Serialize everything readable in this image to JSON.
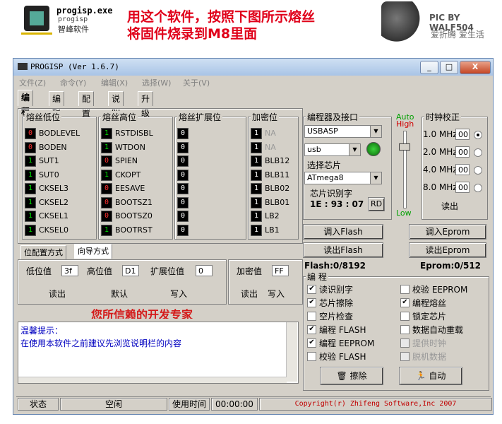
{
  "banner": {
    "app_file": "progisp.exe",
    "app_file2": "progisp",
    "app_cn": "智峰软件",
    "headline1": "用这个软件，按照下图所示熔丝",
    "headline2": "将固件烧录到M8里面",
    "picby": "PIC BY WALF504",
    "slogan": "爱折腾 爱生活"
  },
  "window": {
    "title": "PROGISP  (Ver 1.6.7)",
    "min": "_",
    "max": "□",
    "close": "X"
  },
  "menu": [
    "文件(Z)",
    "命令(Y)",
    "编辑(X)",
    "选择(W)",
    "关于(V)"
  ],
  "tabs": [
    "编 程",
    "编 辑",
    "配 置",
    "说 明",
    "升 级"
  ],
  "fuse": {
    "low_title": "熔丝低位",
    "high_title": "熔丝高位",
    "ext_title": "熔丝扩展位",
    "lock_title": "加密位",
    "low": [
      {
        "v": "0",
        "n": "BODLEVEL"
      },
      {
        "v": "0",
        "n": "BODEN"
      },
      {
        "v": "1",
        "n": "SUT1"
      },
      {
        "v": "1",
        "n": "SUT0"
      },
      {
        "v": "1",
        "n": "CKSEL3"
      },
      {
        "v": "1",
        "n": "CKSEL2"
      },
      {
        "v": "1",
        "n": "CKSEL1"
      },
      {
        "v": "1",
        "n": "CKSEL0"
      }
    ],
    "high": [
      {
        "v": "1",
        "n": "RSTDISBL"
      },
      {
        "v": "1",
        "n": "WTDON"
      },
      {
        "v": "0",
        "n": "SPIEN"
      },
      {
        "v": "1",
        "n": "CKOPT"
      },
      {
        "v": "0",
        "n": "EESAVE"
      },
      {
        "v": "0",
        "n": "BOOTSZ1"
      },
      {
        "v": "0",
        "n": "BOOTSZ0"
      },
      {
        "v": "1",
        "n": "BOOTRST"
      }
    ],
    "ext": [
      "0",
      "0",
      "0",
      "0",
      "0",
      "0",
      "0",
      "0"
    ],
    "lock": [
      {
        "v": "1",
        "n": "NA"
      },
      {
        "v": "1",
        "n": "NA"
      },
      {
        "v": "1",
        "n": "BLB12"
      },
      {
        "v": "1",
        "n": "BLB11"
      },
      {
        "v": "1",
        "n": "BLB02"
      },
      {
        "v": "1",
        "n": "BLB01"
      },
      {
        "v": "1",
        "n": "LB2"
      },
      {
        "v": "1",
        "n": "LB1"
      }
    ]
  },
  "subtabs": [
    "位配置方式",
    "向导方式"
  ],
  "values": {
    "low_label": "低位值",
    "low": "3f",
    "high_label": "高位值",
    "high": "D1",
    "ext_label": "扩展位值",
    "ext": "0",
    "lock_label": "加密值",
    "lock": "FF",
    "read": "读出",
    "default": "默认",
    "write": "写入",
    "read2": "读出",
    "write2": "写入"
  },
  "promo": "您所信赖的开发专家",
  "hint": {
    "title": "温馨提示：",
    "text": "在使用本软件之前建议先浏览说明栏的内容"
  },
  "programmer": {
    "title": "编程器及接口",
    "device": "USBASP",
    "port": "usb",
    "chip_title": "选择芯片",
    "chip": "ATmega8",
    "sig_title": "芯片识别字",
    "sig": "1E : 93 : 07",
    "rd": "RD",
    "auto": "Auto",
    "high": "High",
    "low": "Low"
  },
  "clock": {
    "title": "时钟校正",
    "rows": [
      {
        "f": "1.0 MHz",
        "v": "00",
        "on": true
      },
      {
        "f": "2.0 MHz",
        "v": "00",
        "on": false
      },
      {
        "f": "4.0 MHz",
        "v": "00",
        "on": false
      },
      {
        "f": "8.0 MHz",
        "v": "00",
        "on": false
      }
    ],
    "read": "读出"
  },
  "buttons": {
    "read_flash": "调入Flash",
    "save_flash": "读出Flash",
    "read_eprom": "调入Eprom",
    "save_eprom": "读出Eprom"
  },
  "flash_info": "Flash:0/8192",
  "eprom_info": "Eprom:0/512",
  "program": {
    "title": "编 程",
    "left": [
      {
        "l": "读识别字",
        "c": true,
        "d": false
      },
      {
        "l": "芯片擦除",
        "c": true,
        "d": false
      },
      {
        "l": "空片检查",
        "c": false,
        "d": false
      },
      {
        "l": "编程 FLASH",
        "c": true,
        "d": false
      },
      {
        "l": "编程 EEPROM",
        "c": true,
        "d": false
      },
      {
        "l": "校验 FLASH",
        "c": false,
        "d": false
      }
    ],
    "right": [
      {
        "l": "校验 EEPROM",
        "c": false,
        "d": false
      },
      {
        "l": "编程熔丝",
        "c": true,
        "d": false
      },
      {
        "l": "锁定芯片",
        "c": false,
        "d": false
      },
      {
        "l": "数据自动重载",
        "c": false,
        "d": false
      },
      {
        "l": "提供时钟",
        "c": false,
        "d": true
      },
      {
        "l": "脱机数据",
        "c": false,
        "d": true
      }
    ],
    "erase": "擦除",
    "auto": "自动"
  },
  "status": {
    "state_label": "状态",
    "state": "空闲",
    "time_label": "使用时间",
    "time": "00:00:00",
    "copyright": "Copyright(r) Zhifeng Software,Inc 2007"
  }
}
